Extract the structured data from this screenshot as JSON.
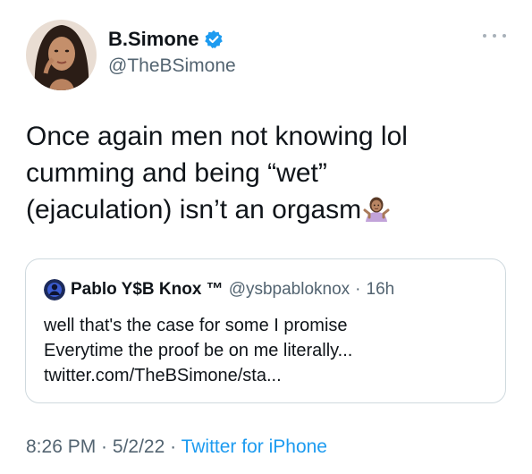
{
  "author": {
    "display_name": "B.Simone",
    "handle": "@TheBSimone",
    "verified": true
  },
  "tweet": {
    "text": "Once again men not knowing lol\ncumming and being “wet”\n(ejaculation) isn’t an orgasm",
    "emoji": "woman-shrugging-emoji"
  },
  "quote": {
    "display_name": "Pablo Y$B Knox ™",
    "handle": "@ysbpabloknox",
    "separator": "·",
    "time": "16h",
    "text": "well that's the case for some I promise\nEverytime the proof be on me literally...\ntwitter.com/TheBSimone/sta..."
  },
  "meta": {
    "time": "8:26 PM",
    "sep1": " · ",
    "date": "5/2/22",
    "sep2": " · ",
    "source": "Twitter for iPhone"
  },
  "colors": {
    "primary_text": "#0f1419",
    "secondary_text": "#536471",
    "link": "#1d9bf0",
    "border": "#cfd9de"
  },
  "icons": {
    "verified": "verified-badge-icon",
    "more": "more-options-icon"
  }
}
